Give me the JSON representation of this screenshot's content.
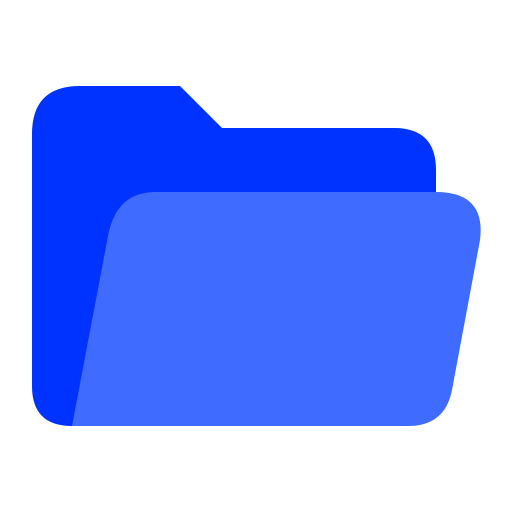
{
  "icon": {
    "name": "open-folder-icon",
    "colors": {
      "back_panel": "#0033FF",
      "front_panel": "#3F6BFF",
      "background": "#FFFFFF"
    }
  }
}
